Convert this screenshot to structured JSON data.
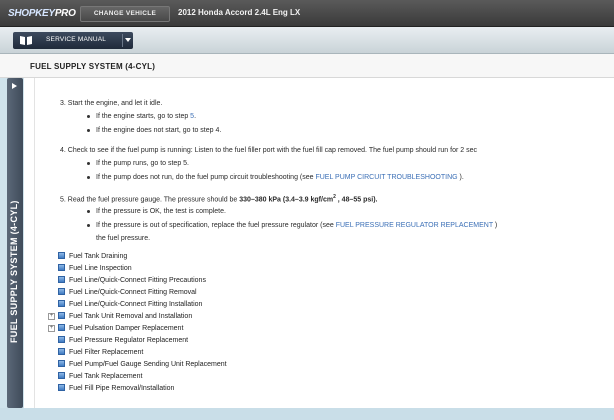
{
  "header": {
    "logo_part1": "SHOPKEY",
    "logo_part2": "PRO",
    "change_vehicle_label": "CHANGE VEHICLE",
    "vehicle": "2012 Honda Accord 2.4L Eng LX"
  },
  "toolbar": {
    "service_manual_label": "SERVICE MANUAL"
  },
  "page": {
    "title": "FUEL SUPPLY SYSTEM (4-CYL)",
    "side_tab_label": "FUEL SUPPLY SYSTEM (4-CYL)"
  },
  "steps": {
    "s3": {
      "text": "3. Start the engine, and let it idle.",
      "b1_pre": "If the engine starts, go to step ",
      "b1_link": "5",
      "b1_post": ".",
      "b2": "If the engine does not start, go to step 4."
    },
    "s4": {
      "text": "4. Check to see if the fuel pump is running: Listen to the fuel filler port with the fuel fill cap removed. The fuel pump should run for 2 sec",
      "b1": "If the pump runs, go to step 5.",
      "b2_pre": "If the pump does not run, do the fuel pump circuit troubleshooting (see ",
      "b2_link": "FUEL PUMP CIRCUIT TROUBLESHOOTING",
      "b2_post": " )."
    },
    "s5": {
      "text_pre": "5. Read the fuel pressure gauge. The pressure should be ",
      "text_bold": "330–380 kPa (3.4–3.9 kgf/cm",
      "text_sup": "2",
      "text_bold2": " , 48–55 psi).",
      "b1": "If the pressure is OK, the test is complete.",
      "b2_pre": "If the pressure is out of specification, replace the fuel pressure regulator (see ",
      "b2_link": "FUEL PRESSURE REGULATOR REPLACEMENT",
      "b2_post": " )",
      "b2_cont": "the fuel pressure."
    }
  },
  "toc": [
    "Fuel Tank Draining",
    "Fuel Line Inspection",
    "Fuel Line/Quick-Connect Fitting Precautions",
    "Fuel Line/Quick-Connect Fitting Removal",
    "Fuel Line/Quick-Connect Fitting Installation",
    "Fuel Tank Unit Removal and Installation",
    "Fuel Pulsation Damper Replacement",
    "Fuel Pressure Regulator Replacement",
    "Fuel Filter Replacement",
    "Fuel Pump/Fuel Gauge Sending Unit Replacement",
    "Fuel Tank Replacement",
    "Fuel Fill Pipe Removal/Installation"
  ],
  "colors": {
    "link": "#3b6fb6",
    "topbar": "#4a4a4a",
    "side_tab": "#4e5b6b"
  }
}
